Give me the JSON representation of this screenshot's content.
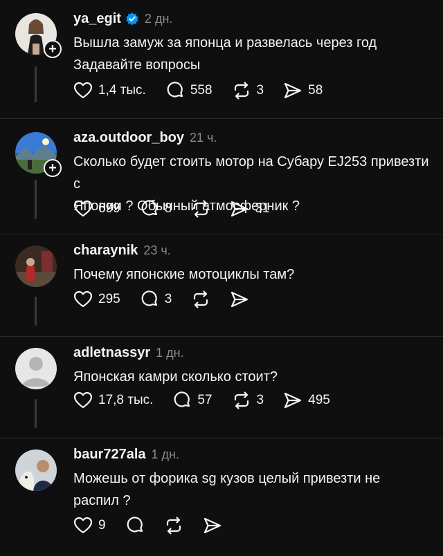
{
  "posts": [
    {
      "username": "ya_egit",
      "verified": true,
      "time": "2 дн.",
      "lines": [
        "Вышла замуж за японца и развелась через год",
        "Задавайте вопросы"
      ],
      "likes": "1,4 тыс.",
      "comments": "558",
      "reposts": "3",
      "shares": "58",
      "has_follow": true,
      "avatar": "woman-photo"
    },
    {
      "username": "aza.outdoor_boy",
      "verified": false,
      "time": "21 ч.",
      "lines": [
        "Сколько будет стоить мотор на Субару EJ253 привезти с",
        "Японии ? Обычный атмосферник ?"
      ],
      "likes": "699",
      "comments": "8",
      "reposts": "",
      "shares": "31",
      "has_follow": true,
      "avatar": "mountain-photo"
    },
    {
      "username": "charaynik",
      "verified": false,
      "time": "23 ч.",
      "lines": [
        "Почему японские мотоциклы там?"
      ],
      "likes": "295",
      "comments": "3",
      "reposts": "",
      "shares": "",
      "has_follow": false,
      "avatar": "street-photo"
    },
    {
      "username": "adletnassyr",
      "verified": false,
      "time": "1 дн.",
      "lines": [
        "Японская камри сколько стоит?"
      ],
      "likes": "17,8 тыс.",
      "comments": "57",
      "reposts": "3",
      "shares": "495",
      "has_follow": false,
      "avatar": "default-avatar"
    },
    {
      "username": "baur727ala",
      "verified": false,
      "time": "1 дн.",
      "lines": [
        "Можешь от форика sg кузов целый привезти не",
        "распил ?"
      ],
      "likes": "9",
      "comments": "",
      "reposts": "",
      "shares": "",
      "has_follow": false,
      "avatar": "man-with-dog-photo"
    }
  ],
  "icons": {
    "like": "heart-icon",
    "comment": "comment-icon",
    "repost": "repost-icon",
    "share": "share-icon",
    "verified": "verified-badge-icon",
    "follow": "plus-icon"
  },
  "colors": {
    "background": "#0f0f0f",
    "text": "#f3f5f7",
    "secondary": "#8a8a8a",
    "verified": "#0095f6",
    "divider": "#2a2a2a"
  }
}
